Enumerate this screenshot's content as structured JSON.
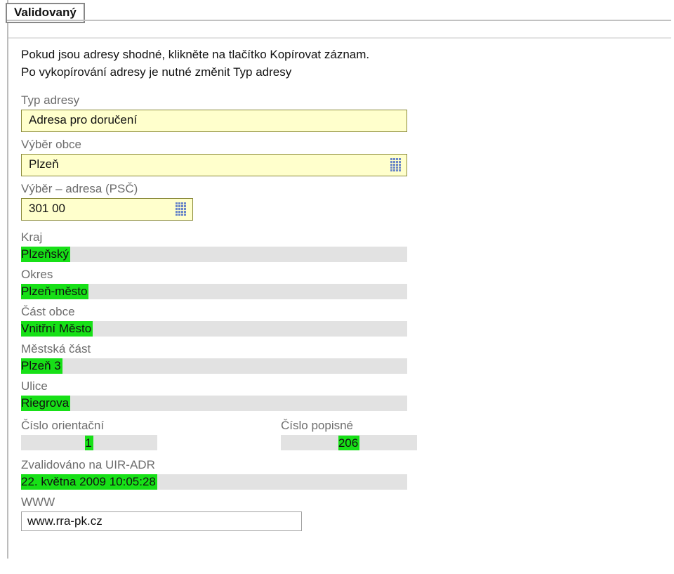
{
  "tab": {
    "label": "Validovaný"
  },
  "intro": {
    "line1": "Pokud jsou adresy shodné, klikněte na tlačítko Kopírovat záznam.",
    "line2": "Po vykopírování adresy je nutné změnit Typ adresy"
  },
  "typAdresy": {
    "label": "Typ adresy",
    "value": "Adresa pro doručení"
  },
  "vyberObce": {
    "label": "Výběr obce",
    "value": "Plzeň"
  },
  "vyberPsc": {
    "label": "Výběr – adresa (PSČ)",
    "value": "301 00"
  },
  "fields": {
    "kraj": {
      "label": "Kraj",
      "value": "Plzeňský"
    },
    "okres": {
      "label": "Okres",
      "value": "Plzeň-město"
    },
    "castObce": {
      "label": "Část obce",
      "value": "Vnitřní Město"
    },
    "mestskaCast": {
      "label": "Městská část",
      "value": "Plzeň 3"
    },
    "ulice": {
      "label": "Ulice",
      "value": "Riegrova"
    },
    "cisloOrientacni": {
      "label": "Číslo orientační",
      "value": "1"
    },
    "cisloPopisne": {
      "label": "Číslo popisné",
      "value": "206"
    },
    "zvalidovano": {
      "label": "Zvalidováno na UIR-ADR",
      "value": "22. května 2009  10:05:28"
    },
    "www": {
      "label": "WWW",
      "value": "www.rra-pk.cz"
    }
  }
}
